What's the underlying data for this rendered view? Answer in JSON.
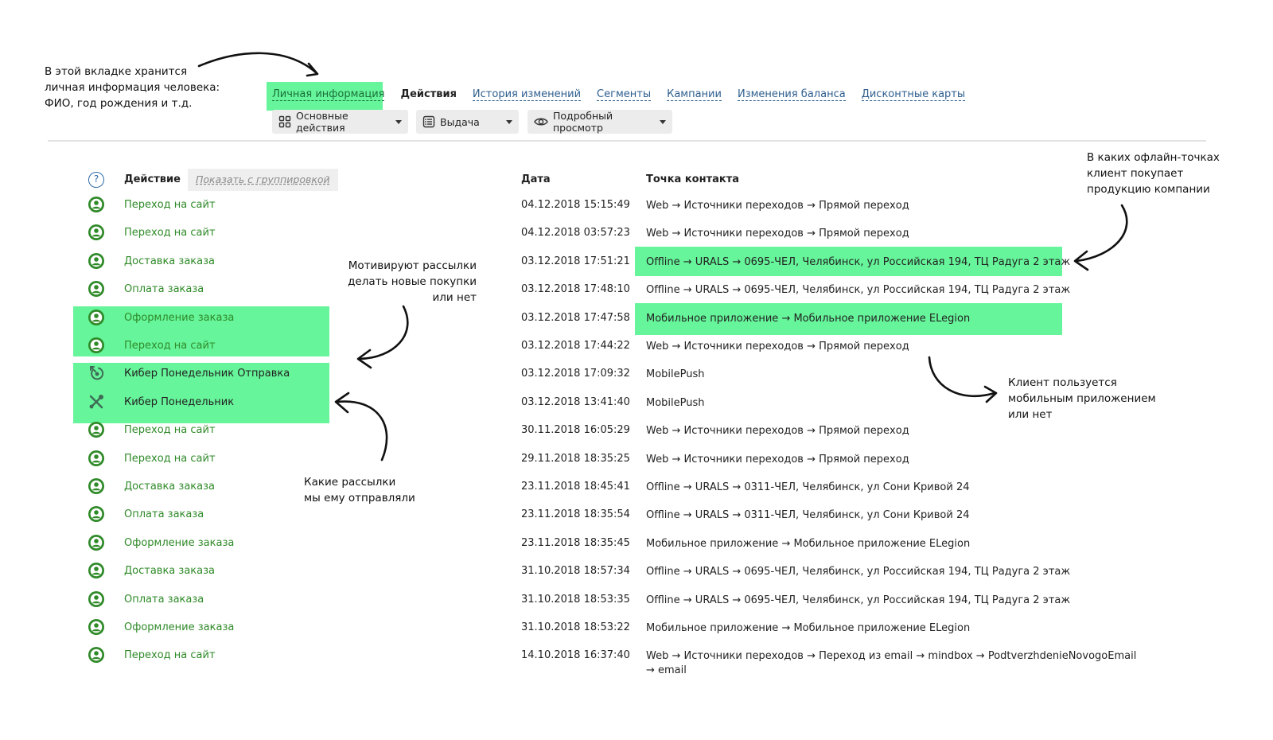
{
  "annotations": {
    "personal_info": "В этой вкладке хранится\nличная информация человека:\nФИО, год рождения и т.д.",
    "offline_points": "В каких офлайн-точках\nклиент покупает\nпродукцию компании",
    "motivate": "Мотивируют рассылки\nделать новые покупки\nили нет",
    "mobile_app": "Клиент пользуется\nмобильным приложением\nили нет",
    "mailings": "Какие рассылки\nмы ему отправляли"
  },
  "tabs": [
    "Личная информация",
    "Действия",
    "История изменений",
    "Сегменты",
    "Кампании",
    "Изменения баланса",
    "Дисконтные карты"
  ],
  "toolbar": {
    "main_actions": "Основные действия",
    "output": "Выдача",
    "detailed_view": "Подробный просмотр"
  },
  "table_header": {
    "help": "?",
    "action": "Действие",
    "group_toggle": "Показать с группировкой",
    "date": "Дата",
    "contact_point": "Точка контакта"
  },
  "rows": [
    {
      "icon": "user-icon",
      "action": "Переход на сайт",
      "date": "04.12.2018 15:15:49",
      "contact": "Web → Источники переходов → Прямой переход"
    },
    {
      "icon": "user-icon",
      "action": "Переход на сайт",
      "date": "04.12.2018 03:57:23",
      "contact": "Web → Источники переходов → Прямой переход"
    },
    {
      "icon": "user-icon",
      "action": "Доставка заказа",
      "date": "03.12.2018 17:51:21",
      "contact": "Offline → URALS → 0695-ЧЕЛ, Челябинск, ул Российская 194, ТЦ Радуга 2 этаж"
    },
    {
      "icon": "user-icon",
      "action": "Оплата заказа",
      "date": "03.12.2018 17:48:10",
      "contact": "Offline → URALS → 0695-ЧЕЛ, Челябинск, ул Российская 194, ТЦ Радуга 2 этаж"
    },
    {
      "icon": "user-icon",
      "action": "Оформление заказа",
      "date": "03.12.2018 17:47:58",
      "contact": "Мобильное приложение → Мобильное приложение ELegion"
    },
    {
      "icon": "user-icon",
      "action": "Переход на сайт",
      "date": "03.12.2018 17:44:22",
      "contact": "Web → Источники переходов → Прямой переход"
    },
    {
      "icon": "mailing-send-icon",
      "action": "Кибер Понедельник Отправка",
      "date": "03.12.2018 17:09:32",
      "contact": "MobilePush"
    },
    {
      "icon": "tools-icon",
      "action": "Кибер Понедельник",
      "date": "03.12.2018 13:41:40",
      "contact": "MobilePush"
    },
    {
      "icon": "user-icon",
      "action": "Переход на сайт",
      "date": "30.11.2018 16:05:29",
      "contact": "Web → Источники переходов → Прямой переход"
    },
    {
      "icon": "user-icon",
      "action": "Переход на сайт",
      "date": "29.11.2018 18:35:25",
      "contact": "Web → Источники переходов → Прямой переход"
    },
    {
      "icon": "user-icon",
      "action": "Доставка заказа",
      "date": "23.11.2018 18:45:41",
      "contact": "Offline → URALS → 0311-ЧЕЛ, Челябинск, ул Сони Кривой 24"
    },
    {
      "icon": "user-icon",
      "action": "Оплата заказа",
      "date": "23.11.2018 18:35:54",
      "contact": "Offline → URALS → 0311-ЧЕЛ, Челябинск, ул Сони Кривой 24"
    },
    {
      "icon": "user-icon",
      "action": "Оформление заказа",
      "date": "23.11.2018 18:35:45",
      "contact": "Мобильное приложение → Мобильное приложение ELegion"
    },
    {
      "icon": "user-icon",
      "action": "Доставка заказа",
      "date": "31.10.2018 18:57:34",
      "contact": "Offline → URALS → 0695-ЧЕЛ, Челябинск, ул Российская 194, ТЦ Радуга 2 этаж"
    },
    {
      "icon": "user-icon",
      "action": "Оплата заказа",
      "date": "31.10.2018 18:53:35",
      "contact": "Offline → URALS → 0695-ЧЕЛ, Челябинск, ул Российская 194, ТЦ Радуга 2 этаж"
    },
    {
      "icon": "user-icon",
      "action": "Оформление заказа",
      "date": "31.10.2018 18:53:22",
      "contact": "Мобильное приложение → Мобильное приложение ELegion"
    },
    {
      "icon": "user-icon",
      "action": "Переход на сайт",
      "date": "14.10.2018 16:37:40",
      "contact": "Web → Источники переходов → Переход из email → mindbox → PodtverzhdenieNovogoEmail → email"
    }
  ],
  "colors": {
    "highlight": "#66f59a",
    "action_green": "#2f8a28",
    "link_blue": "#2e5e8e"
  }
}
